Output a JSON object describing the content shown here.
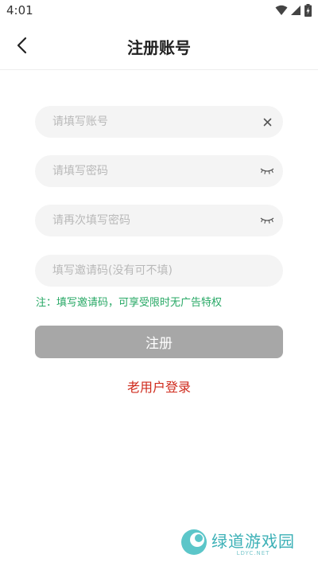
{
  "status_bar": {
    "time": "4:01"
  },
  "header": {
    "title": "注册账号"
  },
  "form": {
    "account_placeholder": "请填写账号",
    "password_placeholder": "请填写密码",
    "confirm_placeholder": "请再次填写密码",
    "invite_placeholder": "填写邀请码(没有可不填)",
    "note": "注：填写邀请码，可享受限时无广告特权",
    "register_label": "注册",
    "old_user_label": "老用户登录"
  },
  "watermark": {
    "brand": "绿道游戏园",
    "sub": "LDYC.NET"
  },
  "colors": {
    "note": "#27a865",
    "link": "#cf2a1c",
    "button": "#a7a7a7"
  }
}
